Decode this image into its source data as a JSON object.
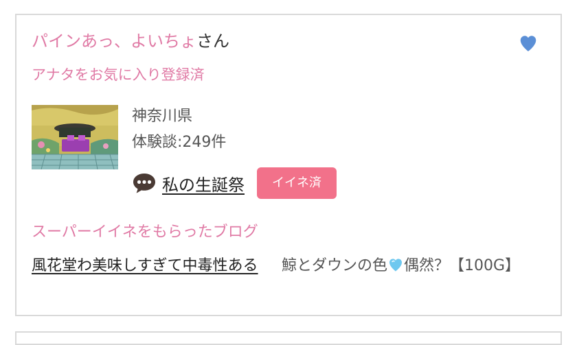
{
  "user": {
    "name": "パインあっ、よいちょ",
    "honorific": "さん",
    "favorite_status": "アナタをお気に入り登録済",
    "heart_icon": "heart-icon",
    "heart_color": "#5b8fd6"
  },
  "profile": {
    "prefecture": "神奈川県",
    "review_count": "体験談:249件"
  },
  "blog": {
    "icon": "speech-bubble-icon",
    "title": "私の生誕祭",
    "iine_label": "イイネ済",
    "iine_color": "#f2718a"
  },
  "super_iine": {
    "heading": "スーパーイイネをもらったブログ",
    "items": [
      {
        "title": "風花堂わ美味しすぎて中毒性ある"
      },
      {
        "title_before": "鯨とダウンの色",
        "emoji": "light-blue-heart-icon",
        "title_after": "偶然？【100G】"
      }
    ]
  },
  "colors": {
    "accent_pink": "#e07aa5",
    "border": "#d9d9d9"
  }
}
